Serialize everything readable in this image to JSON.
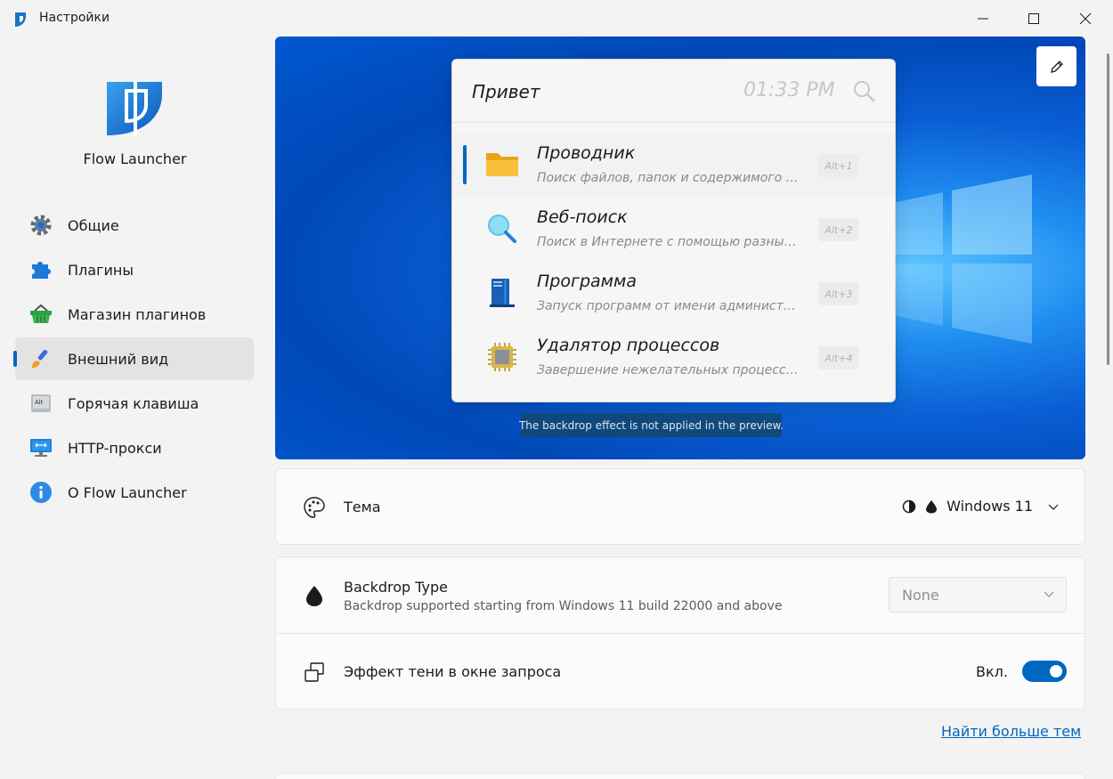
{
  "window": {
    "title": "Настройки",
    "minimize_icon": "minimize-icon",
    "maximize_icon": "maximize-icon",
    "close_icon": "close-icon"
  },
  "sidebar": {
    "brand": "Flow Launcher",
    "items": [
      {
        "label": "Общие",
        "icon": "gear-icon",
        "active": false
      },
      {
        "label": "Плагины",
        "icon": "puzzle-icon",
        "active": false
      },
      {
        "label": "Магазин плагинов",
        "icon": "basket-icon",
        "active": false
      },
      {
        "label": "Внешний вид",
        "icon": "brush-icon",
        "active": true
      },
      {
        "label": "Горячая клавиша",
        "icon": "keyboard-key-icon",
        "active": false
      },
      {
        "label": "HTTP-прокси",
        "icon": "network-icon",
        "active": false
      },
      {
        "label": "О Flow Launcher",
        "icon": "info-icon",
        "active": false
      }
    ],
    "alt_key_text": "Alt"
  },
  "preview": {
    "query": "Привет",
    "clock": "01:33 PM",
    "results": [
      {
        "title": "Проводник",
        "subtitle": "Поиск файлов, папок и содержимого файлов",
        "hotkey": "Alt+1",
        "icon": "folder-icon",
        "selected": true
      },
      {
        "title": "Веб-поиск",
        "subtitle": "Поиск в Интернете с помощью разных поисковых систем",
        "hotkey": "Alt+2",
        "icon": "magnifier-icon",
        "selected": false
      },
      {
        "title": "Программа",
        "subtitle": "Запуск программ от имени администратора",
        "hotkey": "Alt+3",
        "icon": "program-icon",
        "selected": false
      },
      {
        "title": "Удалятор процессов",
        "subtitle": "Завершение нежелательных процессов",
        "hotkey": "Alt+4",
        "icon": "cpu-icon",
        "selected": false
      }
    ],
    "backdrop_note": "The backdrop effect is not applied in the preview."
  },
  "settings": {
    "theme": {
      "label": "Тема",
      "value": "Windows 11"
    },
    "backdrop": {
      "label": "Backdrop Type",
      "description": "Backdrop supported starting from Windows 11 build 22000 and above",
      "value": "None"
    },
    "shadow": {
      "label": "Эффект тени в окне запроса",
      "state_label": "Вкл.",
      "enabled": true
    }
  },
  "more_themes_link": "Найти больше тем",
  "colors": {
    "accent": "#0067c0"
  }
}
